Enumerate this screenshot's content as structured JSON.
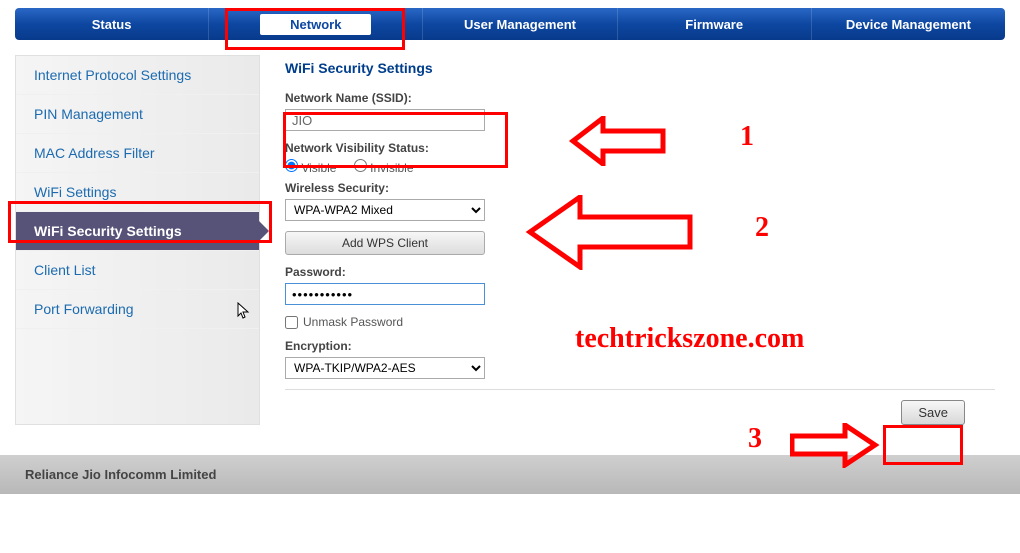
{
  "topnav": {
    "items": [
      {
        "label": "Status"
      },
      {
        "label": "Network"
      },
      {
        "label": "User Management"
      },
      {
        "label": "Firmware"
      },
      {
        "label": "Device Management"
      }
    ]
  },
  "sidebar": {
    "items": [
      {
        "label": "Internet Protocol Settings"
      },
      {
        "label": "PIN Management"
      },
      {
        "label": "MAC Address Filter"
      },
      {
        "label": "WiFi Settings"
      },
      {
        "label": "WiFi Security Settings"
      },
      {
        "label": "Client List"
      },
      {
        "label": "Port Forwarding"
      }
    ]
  },
  "page": {
    "title": "WiFi Security Settings",
    "ssid_label": "Network Name (SSID):",
    "ssid_value": "JIO",
    "visibility_label": "Network Visibility Status:",
    "visibility_visible": "Visible",
    "visibility_invisible": "Invisible",
    "security_label": "Wireless Security:",
    "security_value": "WPA-WPA2 Mixed",
    "wps_button": "Add WPS Client",
    "password_label": "Password:",
    "password_value": "•••••••••••",
    "unmask_label": "Unmask Password",
    "encryption_label": "Encryption:",
    "encryption_value": "WPA-TKIP/WPA2-AES",
    "save_label": "Save"
  },
  "footer": {
    "text": "Reliance Jio Infocomm Limited"
  },
  "annotations": {
    "num1": "1",
    "num2": "2",
    "num3": "3",
    "watermark": "techtrickszone.com"
  }
}
